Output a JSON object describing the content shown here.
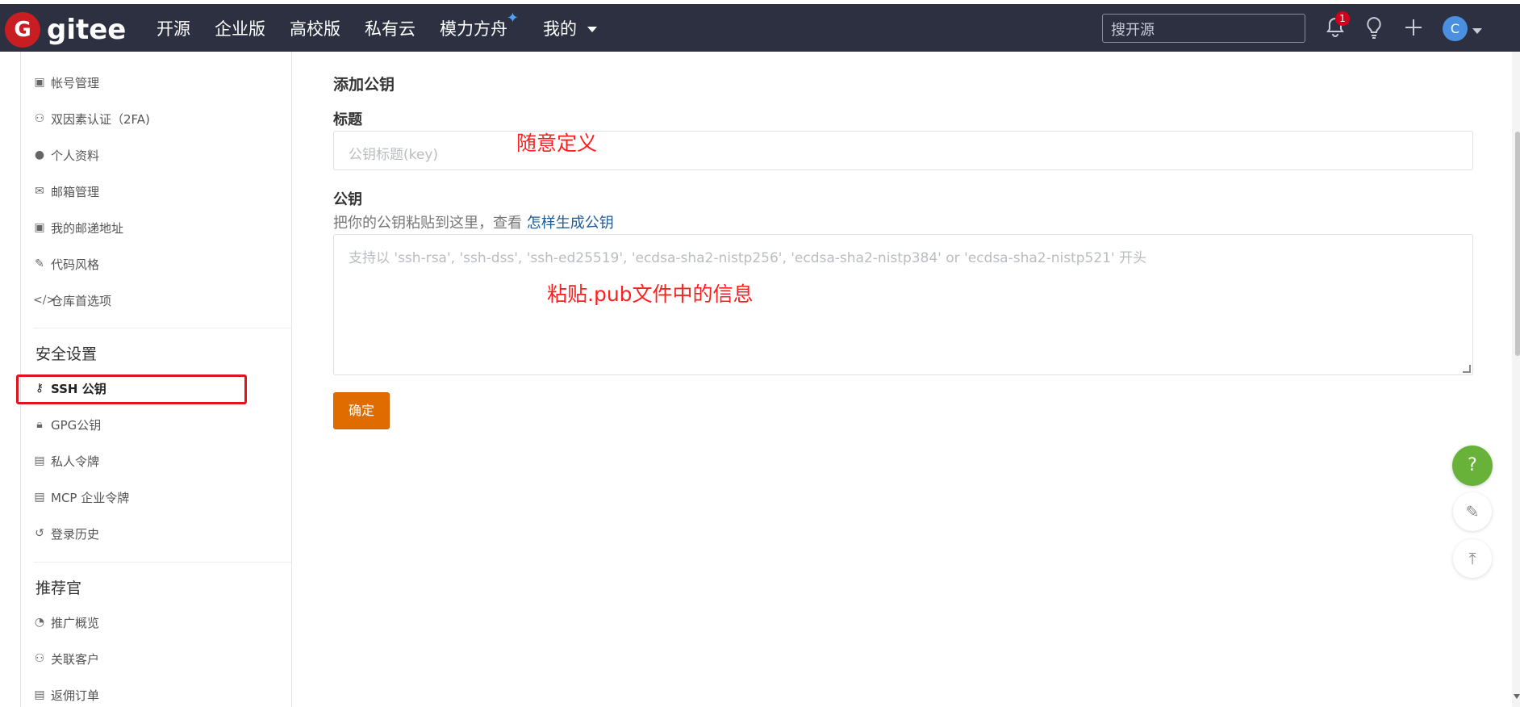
{
  "brand": {
    "name": "gitee",
    "mark": "G"
  },
  "nav": {
    "items": [
      {
        "label": "开源"
      },
      {
        "label": "企业版"
      },
      {
        "label": "高校版"
      },
      {
        "label": "私有云"
      },
      {
        "label": "模力方舟"
      },
      {
        "label": "我的"
      }
    ],
    "search_placeholder": "搜开源",
    "notification_count": "1",
    "avatar_initial": "C"
  },
  "sidebar": {
    "items_top": [
      {
        "label": "帐号管理",
        "icon": "id-card-icon"
      },
      {
        "label": "双因素认证（2FA)",
        "icon": "user-key-icon"
      },
      {
        "label": "个人资料",
        "icon": "user-icon"
      },
      {
        "label": "邮箱管理",
        "icon": "envelope-icon"
      },
      {
        "label": "我的邮递地址",
        "icon": "address-card-icon"
      },
      {
        "label": "代码风格",
        "icon": "brush-icon"
      },
      {
        "label": "仓库首选项",
        "icon": "code-icon"
      }
    ],
    "security_heading": "安全设置",
    "security_items": [
      {
        "label": "SSH 公钥",
        "icon": "key-icon",
        "active": true
      },
      {
        "label": "GPG公钥",
        "icon": "lock-icon"
      },
      {
        "label": "私人令牌",
        "icon": "token-icon"
      },
      {
        "label": "MCP 企业令牌",
        "icon": "token-icon"
      },
      {
        "label": "登录历史",
        "icon": "history-icon"
      }
    ],
    "referral_heading": "推荐官",
    "referral_items": [
      {
        "label": "推广概览",
        "icon": "gauge-icon"
      },
      {
        "label": "关联客户",
        "icon": "user-link-icon"
      },
      {
        "label": "返佣订单",
        "icon": "order-icon"
      }
    ]
  },
  "form": {
    "heading": "添加公钥",
    "title_label": "标题",
    "title_placeholder": "公钥标题(key)",
    "key_label": "公钥",
    "hint_prefix": "把你的公钥粘贴到这里，查看 ",
    "hint_link": "怎样生成公钥",
    "key_placeholder": "支持以 'ssh-rsa', 'ssh-dss', 'ssh-ed25519', 'ecdsa-sha2-nistp256', 'ecdsa-sha2-nistp384' or 'ecdsa-sha2-nistp521' 开头",
    "submit_label": "确定"
  },
  "annotations": {
    "title_note": "随意定义",
    "key_note": "粘贴.pub文件中的信息"
  },
  "floating": {
    "help": "?"
  },
  "colors": {
    "nav_bg": "#2c3041",
    "brand_red": "#c71d23",
    "submit_orange": "#e06c00",
    "help_green": "#69b239",
    "annotation_red": "#ff1f1f",
    "link_blue": "#225c93"
  }
}
